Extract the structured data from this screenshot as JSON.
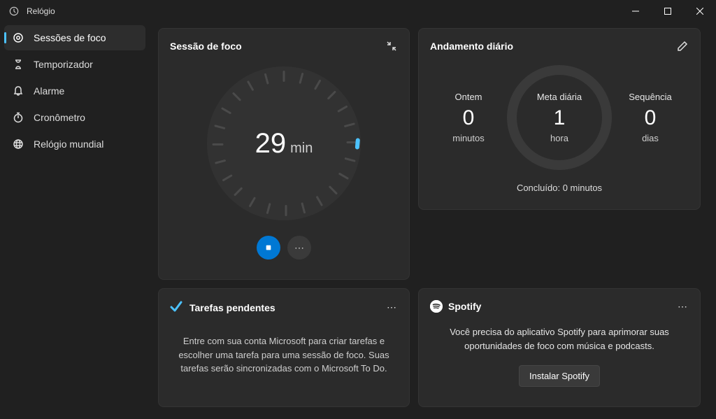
{
  "window": {
    "title": "Relógio"
  },
  "sidebar": {
    "items": [
      {
        "label": "Sessões de foco",
        "active": true
      },
      {
        "label": "Temporizador",
        "active": false
      },
      {
        "label": "Alarme",
        "active": false
      },
      {
        "label": "Cronômetro",
        "active": false
      },
      {
        "label": "Relógio mundial",
        "active": false
      }
    ]
  },
  "focus": {
    "title": "Sessão de foco",
    "value": "29",
    "unit": "min"
  },
  "tasks": {
    "title": "Tarefas pendentes",
    "body": "Entre com sua conta Microsoft para criar tarefas e escolher uma tarefa para uma sessão de foco. Suas tarefas serão sincronizadas com o Microsoft To Do."
  },
  "progress": {
    "title": "Andamento diário",
    "yesterday_label": "Ontem",
    "yesterday_value": "0",
    "yesterday_unit": "minutos",
    "goal_label": "Meta diária",
    "goal_value": "1",
    "goal_unit": "hora",
    "streak_label": "Sequência",
    "streak_value": "0",
    "streak_unit": "dias",
    "completed": "Concluído: 0 minutos"
  },
  "spotify": {
    "title": "Spotify",
    "body": "Você precisa do aplicativo Spotify para aprimorar suas oportunidades de foco com música e podcasts.",
    "install_label": "Instalar Spotify"
  }
}
